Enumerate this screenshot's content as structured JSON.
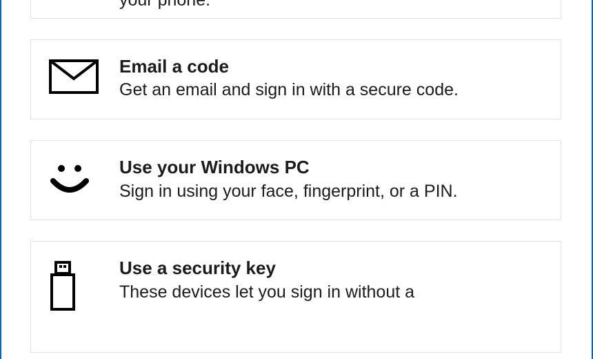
{
  "options": {
    "partial_top": {
      "description_fragment": "your phone."
    },
    "email": {
      "title": "Email a code",
      "description": "Get an email and sign in with a secure code."
    },
    "windows_pc": {
      "title": "Use your Windows PC",
      "description": "Sign in using your face, fingerprint, or a PIN."
    },
    "security_key": {
      "title": "Use a security key",
      "description": "These devices let you sign in without a"
    }
  }
}
